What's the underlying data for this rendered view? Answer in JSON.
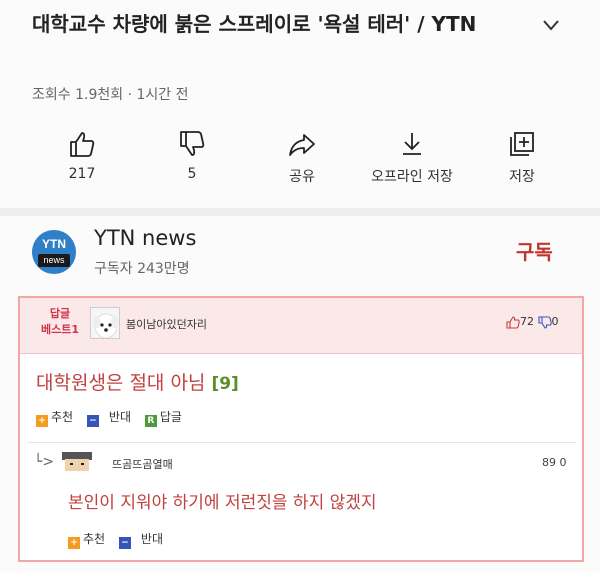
{
  "video": {
    "title": "대학교수 차량에 붉은 스프레이로 '욕설 테러' / YTN",
    "meta": "조회수 1.9천회 · 1시간 전"
  },
  "actions": [
    {
      "icon": "thumbs-up-icon",
      "label": "217"
    },
    {
      "icon": "thumbs-down-icon",
      "label": "5"
    },
    {
      "icon": "share-icon",
      "label": "공유"
    },
    {
      "icon": "download-icon",
      "label": "오프라인 저장"
    },
    {
      "icon": "save-playlist-icon",
      "label": "저장"
    }
  ],
  "channel": {
    "logo_top": "YTN",
    "logo_bottom": "news",
    "name": "YTN news",
    "subscribers": "구독자 243만명",
    "subscribe_label": "구독"
  },
  "comments": {
    "best_label_1": "답글",
    "best_label_2": "베스트1",
    "author": "봄이남아있던자리",
    "likes": "72",
    "dislikes": "0",
    "text": "대학원생은 절대 아님",
    "reply_count": "[9]",
    "buttons": [
      "추천",
      "반대",
      "답글"
    ],
    "reply": {
      "arrow": "└>",
      "author": "뜨곰뜨곰열매",
      "score": "89 0",
      "text": "본인이 지워야 하기에 저런짓을 하지 않겠지",
      "buttons": [
        "추천",
        "반대"
      ]
    }
  },
  "colors": {
    "accent": "#c0362c",
    "comment_text": "#c24040",
    "best_bg": "#fbe9ea",
    "border": "#f2a6a6"
  }
}
